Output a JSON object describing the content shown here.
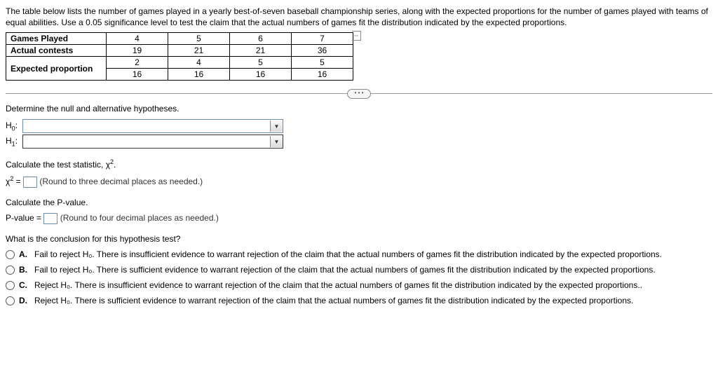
{
  "problem": {
    "text": "The table below lists the number of games played in a yearly best-of-seven baseball championship series, along with the expected proportions for the number of games played with teams of equal abilities. Use a 0.05 significance level to test the claim that the actual numbers of games fit the distribution indicated by the expected proportions."
  },
  "table": {
    "row1_label": "Games Played",
    "row1_values": [
      "4",
      "5",
      "6",
      "7"
    ],
    "row2_label": "Actual contests",
    "row2_values": [
      "19",
      "21",
      "21",
      "36"
    ],
    "row3_label": "Expected proportion",
    "row3_num": [
      "2",
      "4",
      "5",
      "5"
    ],
    "row3_den": [
      "16",
      "16",
      "16",
      "16"
    ]
  },
  "scroll_glyph": "⇔",
  "divider_glyph": "• • •",
  "q1": {
    "prompt": "Determine the null and alternative hypotheses.",
    "h0_label": "H",
    "h0_sub": "0",
    "h1_label": "H",
    "h1_sub": "1",
    "colon": ":"
  },
  "q2": {
    "prompt": "Calculate the test statistic, χ",
    "sup": "2",
    "period": ".",
    "lhs": "χ",
    "lhs_sup": "2",
    "eq": " = ",
    "hint": "(Round to three decimal places as needed.)"
  },
  "q3": {
    "prompt": "Calculate the P-value.",
    "lhs": "P-value = ",
    "hint": "(Round to four decimal places as needed.)"
  },
  "q4": {
    "prompt": "What is the conclusion for this hypothesis test?",
    "options": {
      "A": {
        "label": "A.",
        "text": "Fail to reject H₀. There is insufficient evidence to warrant rejection of the claim that the actual numbers of games fit the distribution indicated by the expected proportions."
      },
      "B": {
        "label": "B.",
        "text": "Fail to reject H₀. There is sufficient evidence to warrant rejection of the claim that the actual numbers of games fit the distribution indicated by the expected proportions."
      },
      "C": {
        "label": "C.",
        "text": "Reject H₀. There is insufficient evidence to warrant rejection of the claim that the actual numbers of games fit the distribution indicated by the expected proportions.."
      },
      "D": {
        "label": "D.",
        "text": "Reject H₀. There is sufficient evidence to warrant rejection of the claim that the actual numbers of games fit the distribution indicated by the expected proportions."
      }
    }
  }
}
